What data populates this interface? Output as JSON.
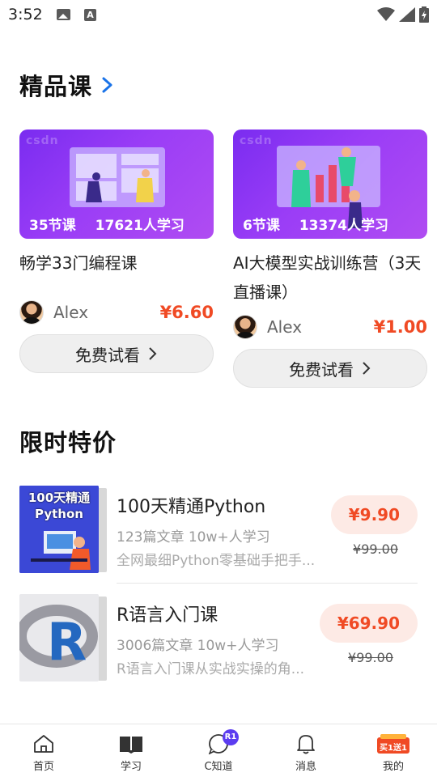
{
  "status_bar": {
    "time": "3:52"
  },
  "featured": {
    "title": "精品课"
  },
  "courses": [
    {
      "lessons": "35节课",
      "learners": "17621人学习",
      "title": "畅学33门编程课",
      "author": "Alex",
      "price": "¥6.60",
      "trial": "免费试看"
    },
    {
      "lessons": "6节课",
      "learners": "13374人学习",
      "title": "AI大模型实战训练营（3天直播课）",
      "author": "Alex",
      "price": "¥1.00",
      "trial": "免费试看"
    }
  ],
  "deals_section": {
    "title": "限时特价"
  },
  "deals": [
    {
      "cover_text_1": "100天精通",
      "cover_text_2": "Python",
      "title": "100天精通Python",
      "meta": "123篇文章   10w+人学习",
      "desc": "全网最细Python零基础手把手...",
      "price": "¥9.90",
      "orig": "¥99.00"
    },
    {
      "cover_text_1": "R",
      "title": "R语言入门课",
      "meta": "3006篇文章   10w+人学习",
      "desc": "R语言入门课从实战实操的角...",
      "price": "¥69.90",
      "orig": "¥99.00"
    }
  ],
  "nav": [
    {
      "label": "首页",
      "icon": "home-icon"
    },
    {
      "label": "学习",
      "icon": "book-icon"
    },
    {
      "label": "C知道",
      "icon": "c-know-icon",
      "badge": "R1"
    },
    {
      "label": "消息",
      "icon": "bell-icon"
    },
    {
      "label": "我的",
      "icon": "profile-promo-icon",
      "promo": "买1送1"
    }
  ],
  "colors": {
    "accent_red": "#f04a24",
    "accent_blue": "#1a73e8",
    "thumb_purple": "#8a35f3"
  }
}
